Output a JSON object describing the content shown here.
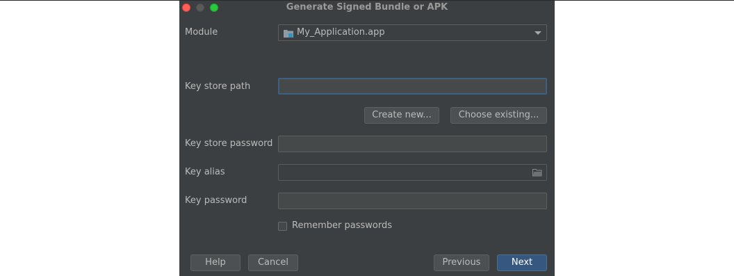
{
  "dialog": {
    "title": "Generate Signed Bundle or APK"
  },
  "module": {
    "label": "Module",
    "selected": "My_Application.app",
    "icon": "module-folder-icon"
  },
  "keystore": {
    "path_label": "Key store path",
    "path_value": "",
    "create_new_label": "Create new...",
    "choose_existing_label": "Choose existing...",
    "password_label": "Key store password",
    "password_value": ""
  },
  "key": {
    "alias_label": "Key alias",
    "alias_value": "",
    "password_label": "Key password",
    "password_value": ""
  },
  "remember": {
    "label": "Remember passwords",
    "checked": false
  },
  "footer": {
    "help_label": "Help",
    "cancel_label": "Cancel",
    "previous_label": "Previous",
    "next_label": "Next"
  },
  "colors": {
    "dialog_bg": "#3c3f41",
    "primary_button": "#365880",
    "focus_border": "#3d6185"
  }
}
